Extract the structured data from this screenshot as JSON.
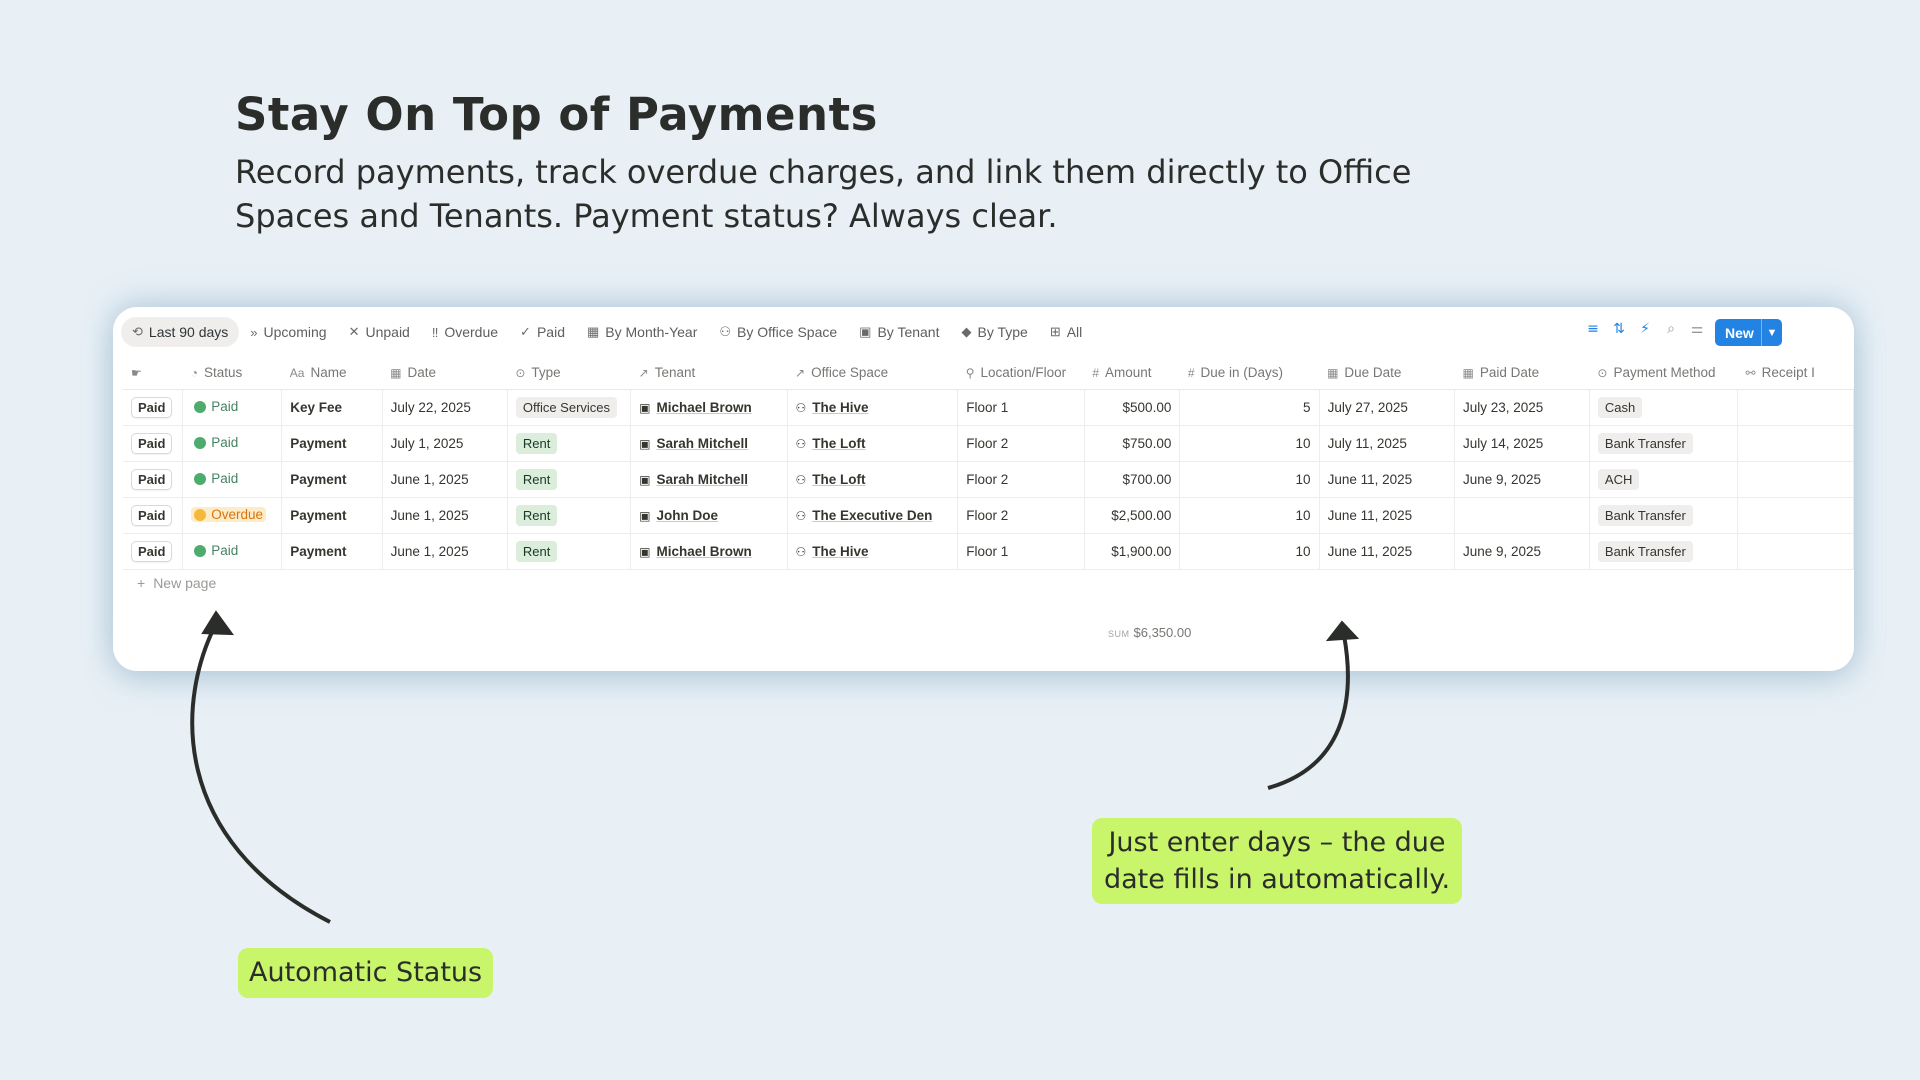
{
  "headline": "Stay On Top of Payments",
  "subline": "Record payments, track overdue charges, and link them directly to Office Spaces and Tenants. Payment status? Always clear.",
  "tabs": [
    {
      "label": "Last 90 days",
      "icon": "history-icon",
      "glyph": "⟲",
      "active": true
    },
    {
      "label": "Upcoming",
      "icon": "fast-forward-icon",
      "glyph": "»"
    },
    {
      "label": "Unpaid",
      "icon": "x-icon",
      "glyph": "✕"
    },
    {
      "label": "Overdue",
      "icon": "double-exclamation-icon",
      "glyph": "‼"
    },
    {
      "label": "Paid",
      "icon": "check-icon",
      "glyph": "✓"
    },
    {
      "label": "By Month-Year",
      "icon": "calendar-icon",
      "glyph": "▦"
    },
    {
      "label": "By Office Space",
      "icon": "people-icon",
      "glyph": "⚇"
    },
    {
      "label": "By Tenant",
      "icon": "id-card-icon",
      "glyph": "▣"
    },
    {
      "label": "By Type",
      "icon": "tag-icon",
      "glyph": "◆"
    },
    {
      "label": "All",
      "icon": "table-icon",
      "glyph": "⊞"
    }
  ],
  "toolbar": {
    "new_label": "New"
  },
  "columns": [
    "",
    "Status",
    "Name",
    "Date",
    "Type",
    "Tenant",
    "Office Space",
    "Location/Floor",
    "Amount",
    "Due in (Days)",
    "Due Date",
    "Paid Date",
    "Payment Method",
    "Receipt I"
  ],
  "column_icons": [
    "button-icon",
    "status-icon",
    "text-icon",
    "calendar-icon",
    "select-icon",
    "relation-icon",
    "relation-icon",
    "pin-icon",
    "number-icon",
    "number-icon",
    "calendar-icon",
    "calendar-icon",
    "select-icon",
    "link-icon"
  ],
  "rows": [
    {
      "button": "Paid",
      "status": "Paid",
      "status_color": "green",
      "name": "Key Fee",
      "date": "July 22, 2025",
      "type": "Office Services",
      "type_color": "gray",
      "tenant": "Michael Brown",
      "office": "The Hive",
      "floor": "Floor 1",
      "amount": "$500.00",
      "due_days": "5",
      "due_date": "July 27, 2025",
      "paid_date": "July 23, 2025",
      "method": "Cash"
    },
    {
      "button": "Paid",
      "status": "Paid",
      "status_color": "green",
      "name": "Payment",
      "date": "July 1, 2025",
      "type": "Rent",
      "type_color": "green",
      "tenant": "Sarah Mitchell",
      "office": "The Loft",
      "floor": "Floor 2",
      "amount": "$750.00",
      "due_days": "10",
      "due_date": "July 11, 2025",
      "paid_date": "July 14, 2025",
      "method": "Bank Transfer"
    },
    {
      "button": "Paid",
      "status": "Paid",
      "status_color": "green",
      "name": "Payment",
      "date": "June 1, 2025",
      "type": "Rent",
      "type_color": "green",
      "tenant": "Sarah Mitchell",
      "office": "The Loft",
      "floor": "Floor 2",
      "amount": "$700.00",
      "due_days": "10",
      "due_date": "June 11, 2025",
      "paid_date": "June 9, 2025",
      "method": "ACH"
    },
    {
      "button": "Paid",
      "status": "Overdue",
      "status_color": "orange",
      "name": "Payment",
      "date": "June 1, 2025",
      "type": "Rent",
      "type_color": "green",
      "tenant": "John Doe",
      "office": "The Executive Den",
      "floor": "Floor 2",
      "amount": "$2,500.00",
      "due_days": "10",
      "due_date": "June 11, 2025",
      "paid_date": "",
      "method": "Bank Transfer"
    },
    {
      "button": "Paid",
      "status": "Paid",
      "status_color": "green",
      "name": "Payment",
      "date": "June 1, 2025",
      "type": "Rent",
      "type_color": "green",
      "tenant": "Michael Brown",
      "office": "The Hive",
      "floor": "Floor 1",
      "amount": "$1,900.00",
      "due_days": "10",
      "due_date": "June 11, 2025",
      "paid_date": "June 9, 2025",
      "method": "Bank Transfer"
    }
  ],
  "new_page_label": "New page",
  "sum": {
    "label": "SUM",
    "value": "$6,350.00"
  },
  "callouts": {
    "status": "Automatic Status",
    "due": "Just enter days – the due date fills in automatically."
  }
}
